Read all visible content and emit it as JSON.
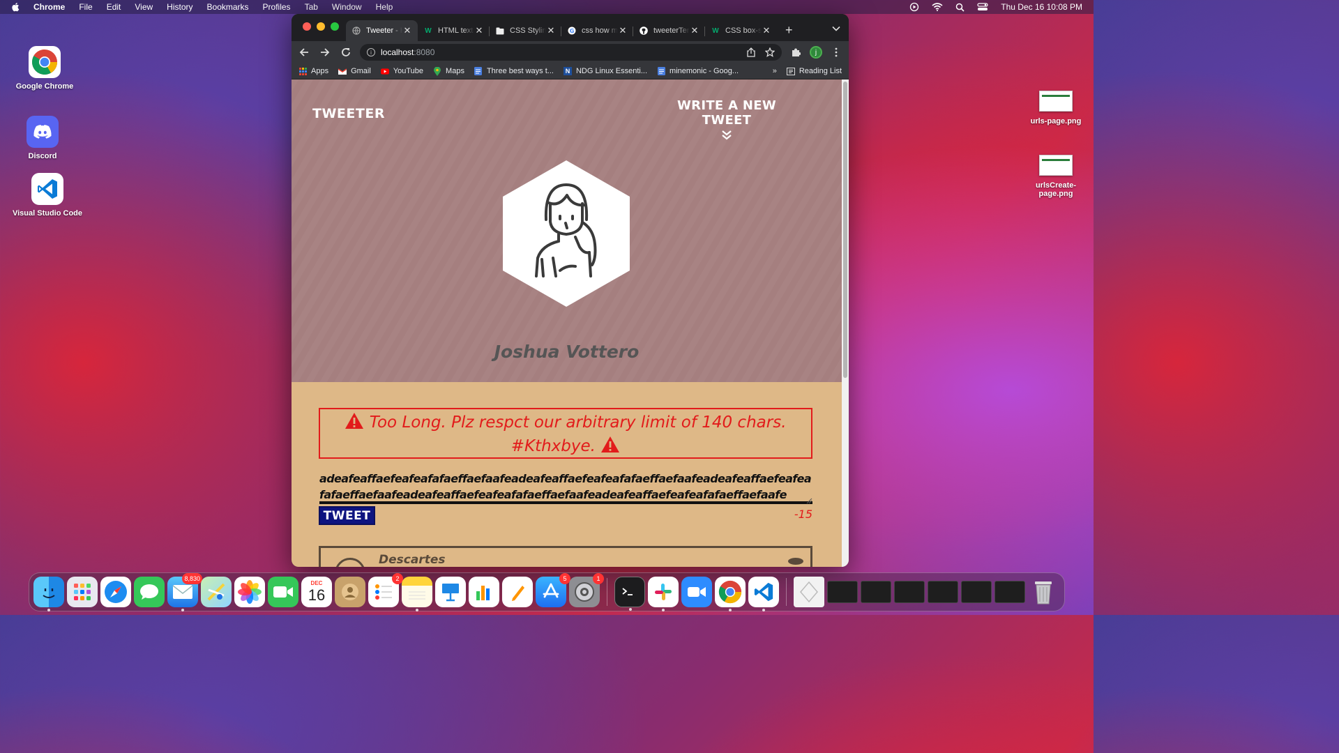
{
  "menubar": {
    "app": "Chrome",
    "items": [
      "File",
      "Edit",
      "View",
      "History",
      "Bookmarks",
      "Profiles",
      "Tab",
      "Window",
      "Help"
    ],
    "clock": "Thu Dec 16  10:08 PM"
  },
  "desktop": {
    "apps": [
      {
        "label": "Google Chrome"
      },
      {
        "label": "Discord"
      },
      {
        "label": "Visual Studio Code"
      }
    ],
    "files": [
      {
        "label": "urls-page.png"
      },
      {
        "label": "urlsCreate-\npage.png"
      }
    ]
  },
  "browser": {
    "tabs": [
      {
        "label": "Tweeter - H",
        "active": true
      },
      {
        "label": "HTML texta",
        "active": false
      },
      {
        "label": "CSS Styling",
        "active": false
      },
      {
        "label": "css how m",
        "active": false
      },
      {
        "label": "tweeterTen",
        "active": false
      },
      {
        "label": "CSS box-si",
        "active": false
      }
    ],
    "url_host": "localhost",
    "url_port": ":8080",
    "profile_initial": "j",
    "bookmarks": [
      {
        "label": "Apps",
        "icon": "apps-grid-icon"
      },
      {
        "label": "Gmail",
        "icon": "gmail-icon"
      },
      {
        "label": "YouTube",
        "icon": "youtube-icon"
      },
      {
        "label": "Maps",
        "icon": "maps-icon"
      },
      {
        "label": "Three best ways t...",
        "icon": "doc-icon"
      },
      {
        "label": "NDG Linux Essenti...",
        "icon": "ndg-icon"
      },
      {
        "label": "minemonic - Goog...",
        "icon": "doc-icon"
      }
    ],
    "reading_list": "Reading List"
  },
  "page": {
    "brand": "TWEETER",
    "write_new": "WRITE A NEW TWEET",
    "user_name": "Joshua Vottero",
    "error_line1": "Too Long. Plz respct our arbitrary limit of 140 chars.",
    "error_line2": "#Kthxbye.",
    "tweet_text": "adeafeaffaefeafeafafaeffaefaafeadeafeaffaefeafeafafaeffaefaafeadeafeaffaefeafeafafaeffaefaafeadeafeaffaefeafeafafaeffaefaafeadeafeaffaefeafeafafaeffaefaafe",
    "tweet_button": "TWEET",
    "counter": "-15",
    "card_name": "Descartes",
    "colors": {
      "header_bg": "#a88383",
      "body_bg": "#deb887",
      "error": "#e21b1b",
      "button_bg": "#0e1480"
    }
  },
  "dock": {
    "badges": {
      "mail": "8,830",
      "reminders": "2",
      "appstore": "5",
      "settings": "1"
    },
    "calendar_month": "DEC",
    "calendar_day": "16"
  }
}
